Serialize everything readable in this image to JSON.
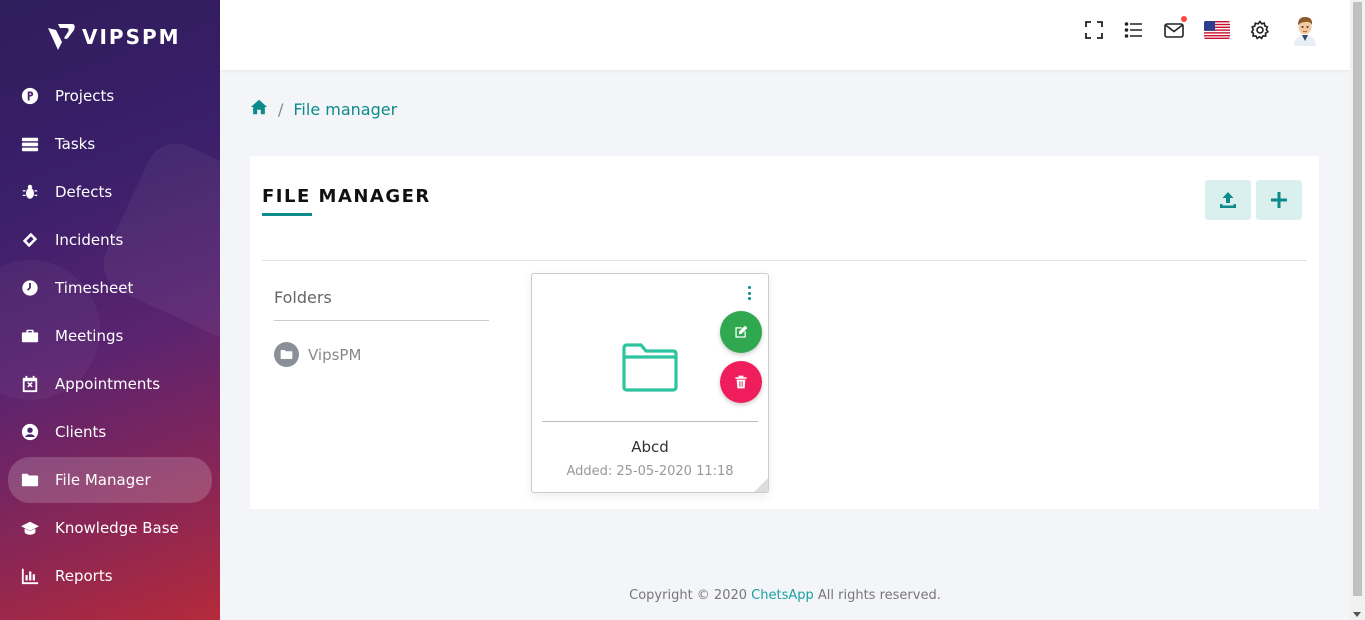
{
  "app": {
    "name": "VIPSPM"
  },
  "sidebar": {
    "items": [
      {
        "label": "Projects",
        "icon": "projects-icon"
      },
      {
        "label": "Tasks",
        "icon": "tasks-icon"
      },
      {
        "label": "Defects",
        "icon": "bug-icon"
      },
      {
        "label": "Incidents",
        "icon": "ticket-icon"
      },
      {
        "label": "Timesheet",
        "icon": "clock-icon"
      },
      {
        "label": "Meetings",
        "icon": "briefcase-icon"
      },
      {
        "label": "Appointments",
        "icon": "calendar-x-icon"
      },
      {
        "label": "Clients",
        "icon": "user-circle-icon"
      },
      {
        "label": "File Manager",
        "icon": "folder-icon",
        "active": true
      },
      {
        "label": "Knowledge Base",
        "icon": "graduation-cap-icon"
      },
      {
        "label": "Reports",
        "icon": "bar-chart-icon"
      }
    ]
  },
  "topbar": {
    "icons": [
      "fullscreen-icon",
      "list-icon",
      "mail-icon",
      "us-flag-icon",
      "settings-icon",
      "user-avatar"
    ]
  },
  "breadcrumb": {
    "home_icon": "home-icon",
    "separator": "/",
    "current": "File manager"
  },
  "file_manager": {
    "title": "FILE MANAGER",
    "buttons": [
      "upload-icon",
      "plus-icon"
    ],
    "folders_label": "Folders",
    "folders": [
      {
        "name": "VipsPM"
      }
    ],
    "files": [
      {
        "name": "Abcd",
        "added": "Added: 25-05-2020 11:18"
      }
    ]
  },
  "footer": {
    "prefix": "Copyright © 2020",
    "brand": "ChetsApp",
    "suffix": "All rights reserved."
  },
  "colors": {
    "accent": "#0d8a8a",
    "edit": "#2fa84f",
    "delete": "#ef1d5b",
    "folder": "#2ec4a0"
  }
}
